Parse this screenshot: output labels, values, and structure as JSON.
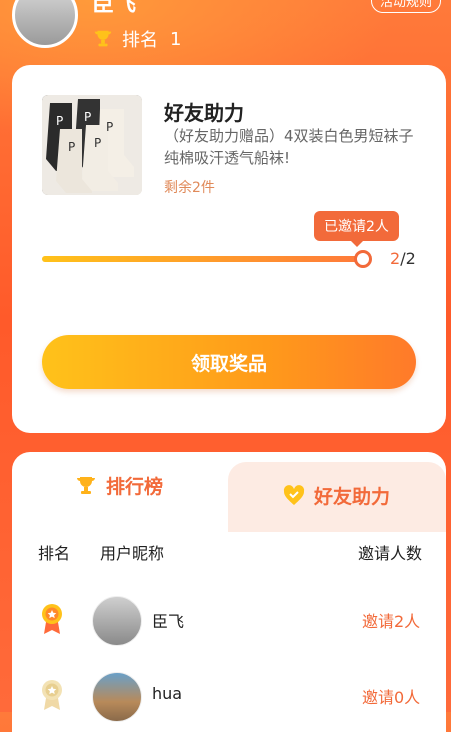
{
  "header": {
    "user_name": "臣飞",
    "rank_label": "排名",
    "rank_value": "1",
    "rules_label": "活动规则"
  },
  "prize": {
    "title": "好友助力",
    "description": "（好友助力赠品）4双装白色男短袜子纯棉吸汗透气船袜!",
    "remaining": "剩余2件",
    "tooltip": "已邀请2人",
    "progress": {
      "current": "2",
      "sep_total": "/2",
      "fraction": 1.0
    },
    "claim_button": "领取奖品"
  },
  "panel": {
    "tabs": [
      {
        "label": "排行榜",
        "icon": "trophy-icon",
        "active": true
      },
      {
        "label": "好友助力",
        "icon": "heart-icon",
        "active": false
      }
    ],
    "columns": {
      "rank": "排名",
      "nickname": "用户昵称",
      "invites": "邀请人数"
    },
    "rows": [
      {
        "name": "臣飞",
        "invites": "邀请2人",
        "medal": "gold-medal-icon"
      },
      {
        "name": "hua",
        "invites": "邀请0人",
        "medal": "silver-medal-icon"
      }
    ]
  },
  "colors": {
    "accent": "#f26a3a",
    "gold": "#ffc21a",
    "background": "#ff6a3a"
  }
}
